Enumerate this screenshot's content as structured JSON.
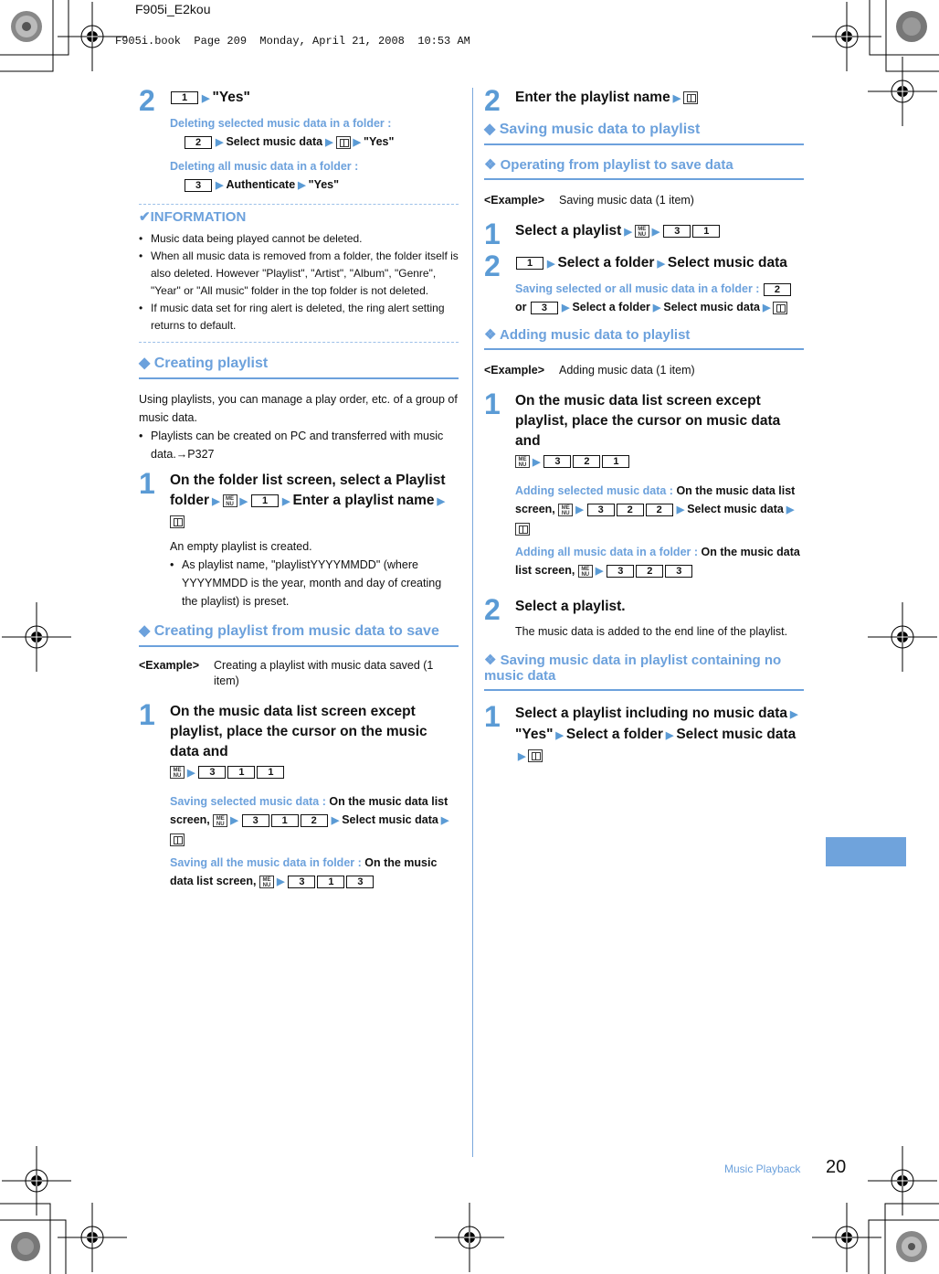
{
  "header": {
    "title": "F905i_E2kou",
    "meta": "F905i.book  Page 209  Monday, April 21, 2008  10:53 AM"
  },
  "left": {
    "step2": {
      "num": "2",
      "key1": "1",
      "text_yes": "\"Yes\"",
      "sub1_label": "Deleting selected music data in a folder :",
      "sub1_key": "2",
      "sub1_text": "Select music data",
      "sub1_yes": "\"Yes\"",
      "sub2_label": "Deleting all music data in a folder :",
      "sub2_key": "3",
      "sub2_text": "Authenticate",
      "sub2_yes": "\"Yes\""
    },
    "information": {
      "title": "✔INFORMATION",
      "items": [
        "Music data being played cannot be deleted.",
        "When all music data is removed from a folder, the folder itself is also deleted. However \"Playlist\", \"Artist\", \"Album\", \"Genre\", \"Year\" or \"All music\" folder in the top folder is not deleted.",
        "If music data set for ring alert is deleted, the ring alert setting returns to default."
      ]
    },
    "creating_playlist": {
      "heading": "◆  Creating playlist",
      "intro": "Using playlists, you can manage a play order, etc. of a group of music data.",
      "bullet": "Playlists can be created on PC and transferred with music data.→P327",
      "step1": {
        "num": "1",
        "text_a": "On the folder list screen, select a Playlist folder",
        "key1": "1",
        "text_b": "Enter a playlist name"
      },
      "note": "An empty playlist is created.",
      "note_bullet": "As playlist name, \"playlistYYYYMMDD\" (where YYYYMMDD is the year, month and day of creating the playlist) is preset."
    },
    "creating_from_music": {
      "heading": "◆  Creating playlist from music data to save",
      "example_label": "<Example>",
      "example_text": "Creating a playlist with music data saved (1 item)",
      "step1": {
        "num": "1",
        "text": "On the music data list screen except playlist, place the cursor on the music data and",
        "keys": [
          "3",
          "1",
          "1"
        ]
      },
      "sub1_label": "Saving selected music data :",
      "sub1_text_a": "On the music data list screen,",
      "sub1_keys": [
        "3",
        "1",
        "2"
      ],
      "sub1_text_b": "Select music data",
      "sub2_label": "Saving all the music data in folder :",
      "sub2_text_a": "On the music data list screen,",
      "sub2_keys": [
        "3",
        "1",
        "3"
      ]
    }
  },
  "right": {
    "step2": {
      "num": "2",
      "text": "Enter the playlist name"
    },
    "saving_heading": "◆  Saving music data to playlist",
    "operating": {
      "heading": "❖ Operating from playlist to save data",
      "example_label": "<Example>",
      "example_text": "Saving music data (1 item)",
      "step1": {
        "num": "1",
        "text": "Select a playlist",
        "keys": [
          "3",
          "1"
        ]
      },
      "step2": {
        "num": "2",
        "key1": "1",
        "text_a": "Select a folder",
        "text_b": "Select music data"
      },
      "sub_label": "Saving selected or all music data in a folder :",
      "sub_key_a": "2",
      "sub_or": "or",
      "sub_key_b": "3",
      "sub_text_a": "Select a folder",
      "sub_text_b": "Select music data"
    },
    "adding": {
      "heading": "❖ Adding music data to playlist",
      "example_label": "<Example>",
      "example_text": "Adding music data (1 item)",
      "step1": {
        "num": "1",
        "text": "On the music data list screen except playlist, place the cursor on music data and",
        "keys": [
          "3",
          "2",
          "1"
        ]
      },
      "sub1_label": "Adding selected music data :",
      "sub1_text_a": "On the music data list screen,",
      "sub1_keys": [
        "3",
        "2",
        "2"
      ],
      "sub1_text_b": "Select music data",
      "sub2_label": "Adding all music data in a folder :",
      "sub2_text_a": "On the music data list screen,",
      "sub2_keys": [
        "3",
        "2",
        "3"
      ],
      "step2": {
        "num": "2",
        "text": "Select a playlist."
      },
      "step2_note": "The music data is added to the end line of the playlist."
    },
    "no_music": {
      "heading": "❖ Saving music data in playlist containing no music data",
      "step1": {
        "num": "1",
        "text_a": "Select a playlist including no music data",
        "text_yes": "\"Yes\"",
        "text_b": "Select a folder",
        "text_c": "Select music data"
      }
    }
  },
  "footer": {
    "section": "Music Playback",
    "page": "20"
  },
  "icons": {
    "arrow": "▶",
    "menu_key": "MENU",
    "book_key": "book-icon"
  },
  "colors": {
    "accent": "#6ca1dc",
    "step_number": "#5b9bd5",
    "tab_marker": "#6fa3dc"
  }
}
